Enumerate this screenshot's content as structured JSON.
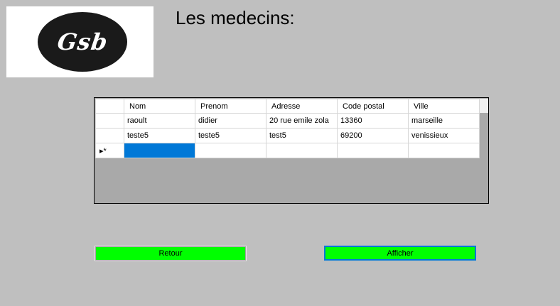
{
  "logo": {
    "text": "Gsb"
  },
  "title": "Les medecins:",
  "grid": {
    "columns": [
      "Nom",
      "Prenom",
      "Adresse",
      "Code postal",
      "Ville"
    ],
    "rows": [
      [
        "raoult",
        "didier",
        "20 rue emile zola",
        "13360",
        "marseille"
      ],
      [
        "teste5",
        "teste5",
        "test5",
        "69200",
        "venissieux"
      ]
    ],
    "new_row_marker": "▸*"
  },
  "buttons": {
    "retour": "Retour",
    "afficher": "Afficher"
  },
  "colors": {
    "button_bg": "#00ff00",
    "selection": "#0078d7",
    "background": "#bfbfbf",
    "grid_bg": "#a9a9a9"
  }
}
